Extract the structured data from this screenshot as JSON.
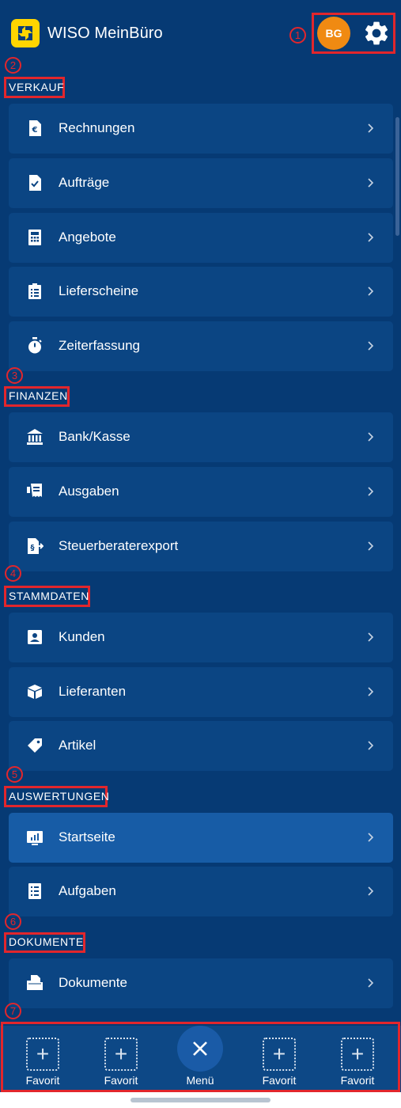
{
  "header": {
    "app_title": "WISO MeinBüro",
    "avatar_initials": "BG",
    "logo_icon": "wiso-logo-icon",
    "settings_icon": "gear-icon"
  },
  "sections": [
    {
      "label": "VERKAUF",
      "items": [
        {
          "label": "Rechnungen",
          "icon": "euro-document-icon"
        },
        {
          "label": "Aufträge",
          "icon": "checked-document-icon"
        },
        {
          "label": "Angebote",
          "icon": "calculator-icon"
        },
        {
          "label": "Lieferscheine",
          "icon": "clipboard-list-icon"
        },
        {
          "label": "Zeiterfassung",
          "icon": "stopwatch-icon"
        }
      ]
    },
    {
      "label": "FINANZEN",
      "items": [
        {
          "label": "Bank/Kasse",
          "icon": "bank-icon"
        },
        {
          "label": "Ausgaben",
          "icon": "receipt-icon"
        },
        {
          "label": "Steuerberaterexport",
          "icon": "paragraph-export-icon"
        }
      ]
    },
    {
      "label": "STAMMDATEN",
      "items": [
        {
          "label": "Kunden",
          "icon": "contact-card-icon"
        },
        {
          "label": "Lieferanten",
          "icon": "package-icon"
        },
        {
          "label": "Artikel",
          "icon": "tag-icon"
        }
      ]
    },
    {
      "label": "AUSWERTUNGEN",
      "items": [
        {
          "label": "Startseite",
          "icon": "bar-chart-icon",
          "active": true
        },
        {
          "label": "Aufgaben",
          "icon": "checklist-icon"
        }
      ]
    },
    {
      "label": "DOKUMENTE",
      "items": [
        {
          "label": "Dokumente",
          "icon": "folder-documents-icon"
        }
      ]
    }
  ],
  "annotations": [
    "1",
    "2",
    "3",
    "4",
    "5",
    "6",
    "7"
  ],
  "bottom_nav": {
    "favorites": [
      "Favorit",
      "Favorit",
      "Favorit",
      "Favorit"
    ],
    "menu_label": "Menü",
    "add_symbol": "+"
  },
  "colors": {
    "background": "#063a74",
    "card": "#0b4583",
    "card_active": "#175ca6",
    "avatar": "#f08a12",
    "logo": "#ffd500",
    "annotation": "#e2262c"
  }
}
